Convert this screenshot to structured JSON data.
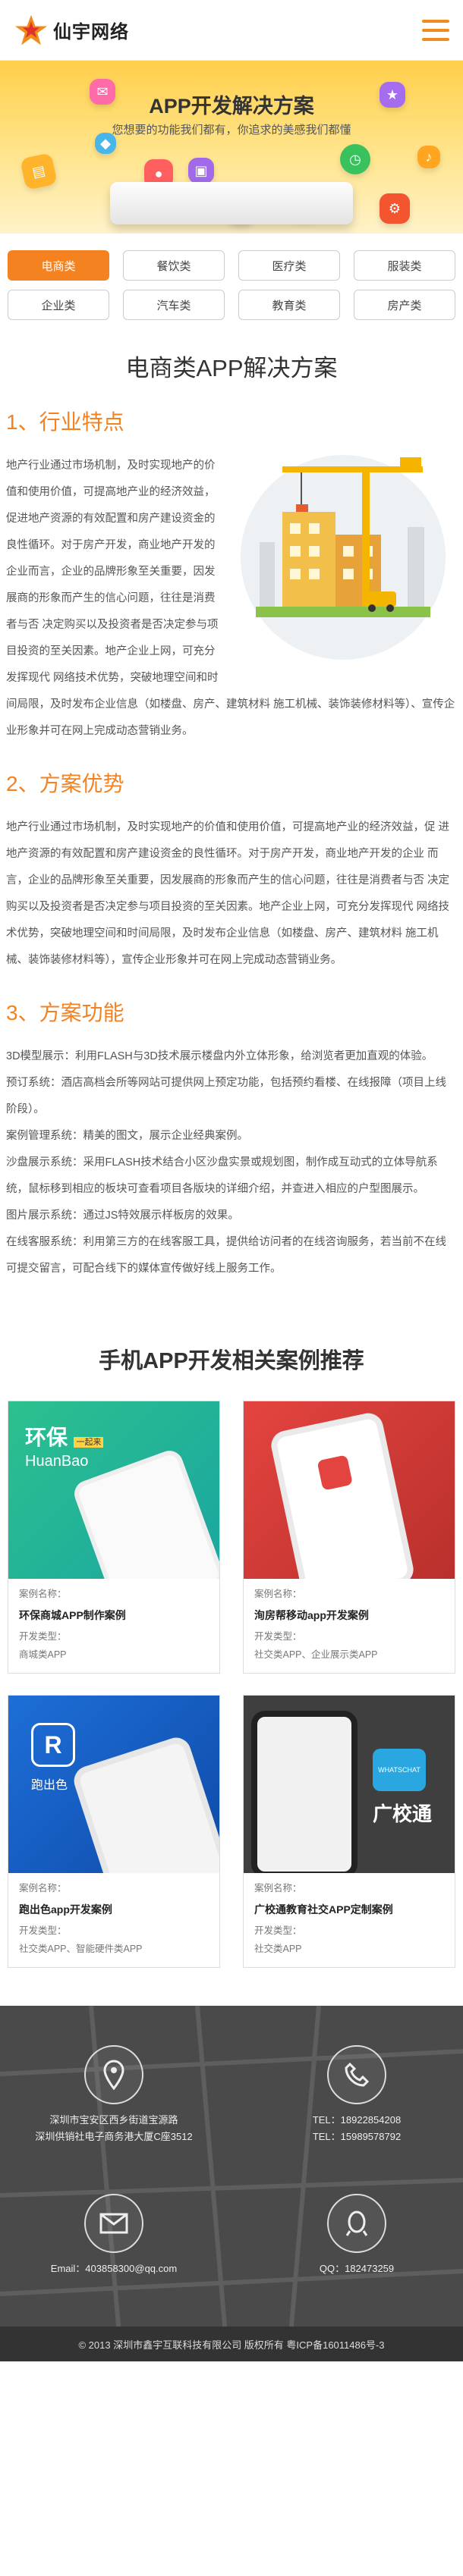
{
  "header": {
    "logo_text": "仙宇网络",
    "logo_icon": "star-logo-icon",
    "menu_icon": "hamburger-menu-icon"
  },
  "banner": {
    "title": "APP开发解决方案",
    "subtitle": "您想要的功能我们都有，你追求的美感我们都懂"
  },
  "categories": [
    {
      "label": "电商类"
    },
    {
      "label": "餐饮类"
    },
    {
      "label": "医疗类"
    },
    {
      "label": "服装类"
    },
    {
      "label": "企业类"
    },
    {
      "label": "汽车类"
    },
    {
      "label": "教育类"
    },
    {
      "label": "房产类"
    }
  ],
  "main": {
    "title": "电商类APP解决方案",
    "sections": [
      {
        "heading": "1、行业特点",
        "text": "地产行业通过市场机制，及时实现地产的价值和使用价值，可提高地产业的经济效益，促进地产资源的有效配置和房产建设资金的良性循环。对于房产开发，商业地产开发的企业而言，企业的品牌形象至关重要，因发展商的形象而产生的信心问题，往往是消费者与否 决定购买以及投资者是否决定参与项目投资的至关因素。地产企业上网，可充分发挥现代 网络技术优势，突破地理空间和时间局限，及时发布企业信息（如楼盘、房产、建筑材料 施工机械、装饰装修材料等）、宣传企业形象并可在网上完成动态营销业务。"
      },
      {
        "heading": "2、方案优势",
        "text": "地产行业通过市场机制，及时实现地产的价值和使用价值，可提高地产业的经济效益，促 进地产资源的有效配置和房产建设资金的良性循环。对于房产开发，商业地产开发的企业 而言，企业的品牌形象至关重要，因发展商的形象而产生的信心问题，往往是消费者与否 决定购买以及投资者是否决定参与项目投资的至关因素。地产企业上网，可充分发挥现代 网络技术优势，突破地理空间和时间局限，及时发布企业信息（如楼盘、房产、建筑材料 施工机械、装饰装修材料等），宣传企业形象并可在网上完成动态营销业务。"
      },
      {
        "heading": "3、方案功能",
        "items": [
          "3D模型展示：利用FLASH与3D技术展示楼盘内外立体形象，给浏览者更加直观的体验。",
          "预订系统：酒店高档会所等网站可提供网上预定功能，包括预约看楼、在线报障（项目上线阶段）。",
          "案例管理系统：精美的图文，展示企业经典案例。",
          "沙盘展示系统：采用FLASH技术结合小区沙盘实景或规划图，制作成互动式的立体导航系统，鼠标移到相应的板块可查看项目各版块的详细介绍，并查进入相应的户型图展示。",
          "图片展示系统：通过JS特效展示样板房的效果。",
          "在线客服系统：利用第三方的在线客服工具，提供给访问者的在线咨询服务，若当前不在线可提交留言，可配合线下的媒体宣传做好线上服务工作。"
        ]
      }
    ]
  },
  "cases": {
    "title": "手机APP开发相关案例推荐",
    "label": "案例名称：",
    "type_label": "开发类型：",
    "items": [
      {
        "name": "环保商城APP制作案例",
        "type": "商城类APP",
        "img_text": "环保",
        "img_sub": "HuanBao",
        "img_tag": "一起来"
      },
      {
        "name": "洵房帮移动app开发案例",
        "type": "社交类APP、企业展示类APP",
        "img_text": "",
        "img_sub": "",
        "img_tag": ""
      },
      {
        "name": "跑出色app开发案例",
        "type": "社交类APP、智能硬件类APP",
        "img_text": "跑出色",
        "img_sub": "",
        "img_tag": ""
      },
      {
        "name": "广校通教育社交APP定制案例",
        "type": "社交类APP",
        "img_text": "广校通",
        "img_sub": "",
        "img_tag": "WHATSCHAT"
      }
    ]
  },
  "footer": {
    "address": "深圳市宝安区西乡街道宝源路\n深圳供销社电子商务港大厦C座3512",
    "phone": "TEL：18922854208\nTEL：15989578792",
    "email": "Email：403858300@qq.com",
    "qq": "QQ：182473259",
    "copyright": "© 2013 深圳市鑫宇互联科技有限公司 版权所有 粤ICP备16011486号-3"
  },
  "colors": {
    "accent": "#f58220",
    "banner": "#ffd34f",
    "footer": "#4a4a4a"
  }
}
